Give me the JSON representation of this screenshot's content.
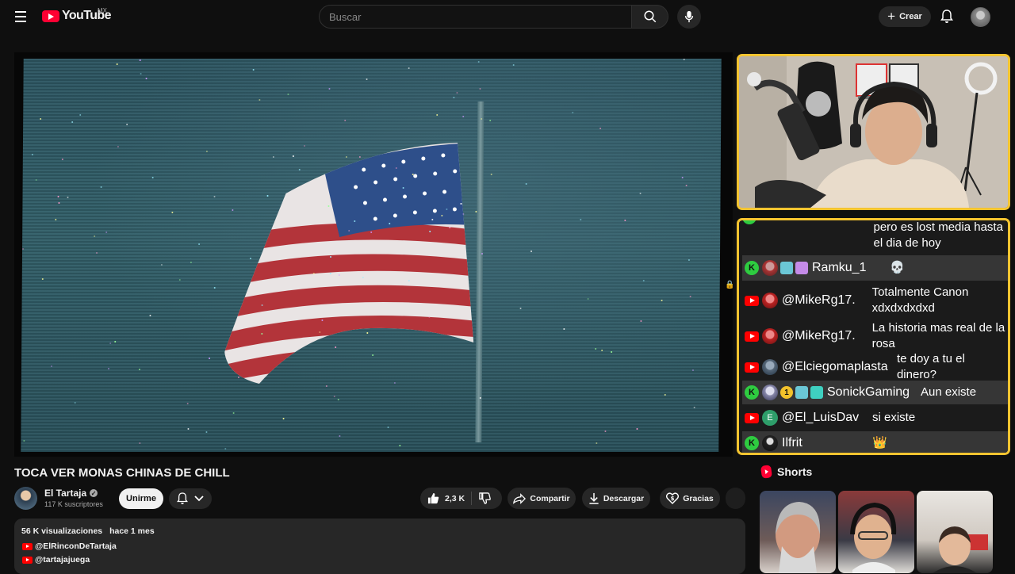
{
  "header": {
    "logo_text": "YouTube",
    "country_code": "MX",
    "search_placeholder": "Buscar",
    "create_label": "Crear"
  },
  "chat": {
    "messages": [
      {
        "platform": "youtube",
        "user": "",
        "text": "pero es lost media hasta el dia de hoy"
      },
      {
        "platform": "kick",
        "user": "Ramku_1",
        "text": "💀"
      },
      {
        "platform": "youtube",
        "user": "@MikeRg17.",
        "text": "Totalmente Canon xdxdxdxdxd"
      },
      {
        "platform": "youtube",
        "user": "@MikeRg17.",
        "text": "La historia mas real de la rosa"
      },
      {
        "platform": "youtube",
        "user": "@Elciegomaplasta",
        "text": "te doy a tu el dinero?"
      },
      {
        "platform": "kick",
        "user": "SonickGaming",
        "text": "Aun existe"
      },
      {
        "platform": "youtube",
        "user": "@El_LuisDav",
        "text": "si existe",
        "avatar_letter": "E"
      },
      {
        "platform": "kick",
        "user": "Ilfrit",
        "text": "👑"
      }
    ],
    "badge_number": "1"
  },
  "video": {
    "title": "TOCA VER MONAS CHINAS DE CHILL",
    "channel_name": "El Tartaja",
    "subscribers": "117 K suscriptores",
    "join_label": "Unirme",
    "likes": "2,3 K",
    "share_label": "Compartir",
    "download_label": "Descargar",
    "thanks_label": "Gracias"
  },
  "description": {
    "views": "56 K visualizaciones",
    "date": "hace 1 mes",
    "links": [
      "@ElRinconDeTartaja",
      "@tartajajuega"
    ]
  },
  "shorts": {
    "title": "Shorts"
  },
  "colors": {
    "accent_red": "#ff0033",
    "overlay_border": "#f4c430",
    "kick_green": "#2ecc40",
    "background": "#0f0f0f"
  }
}
